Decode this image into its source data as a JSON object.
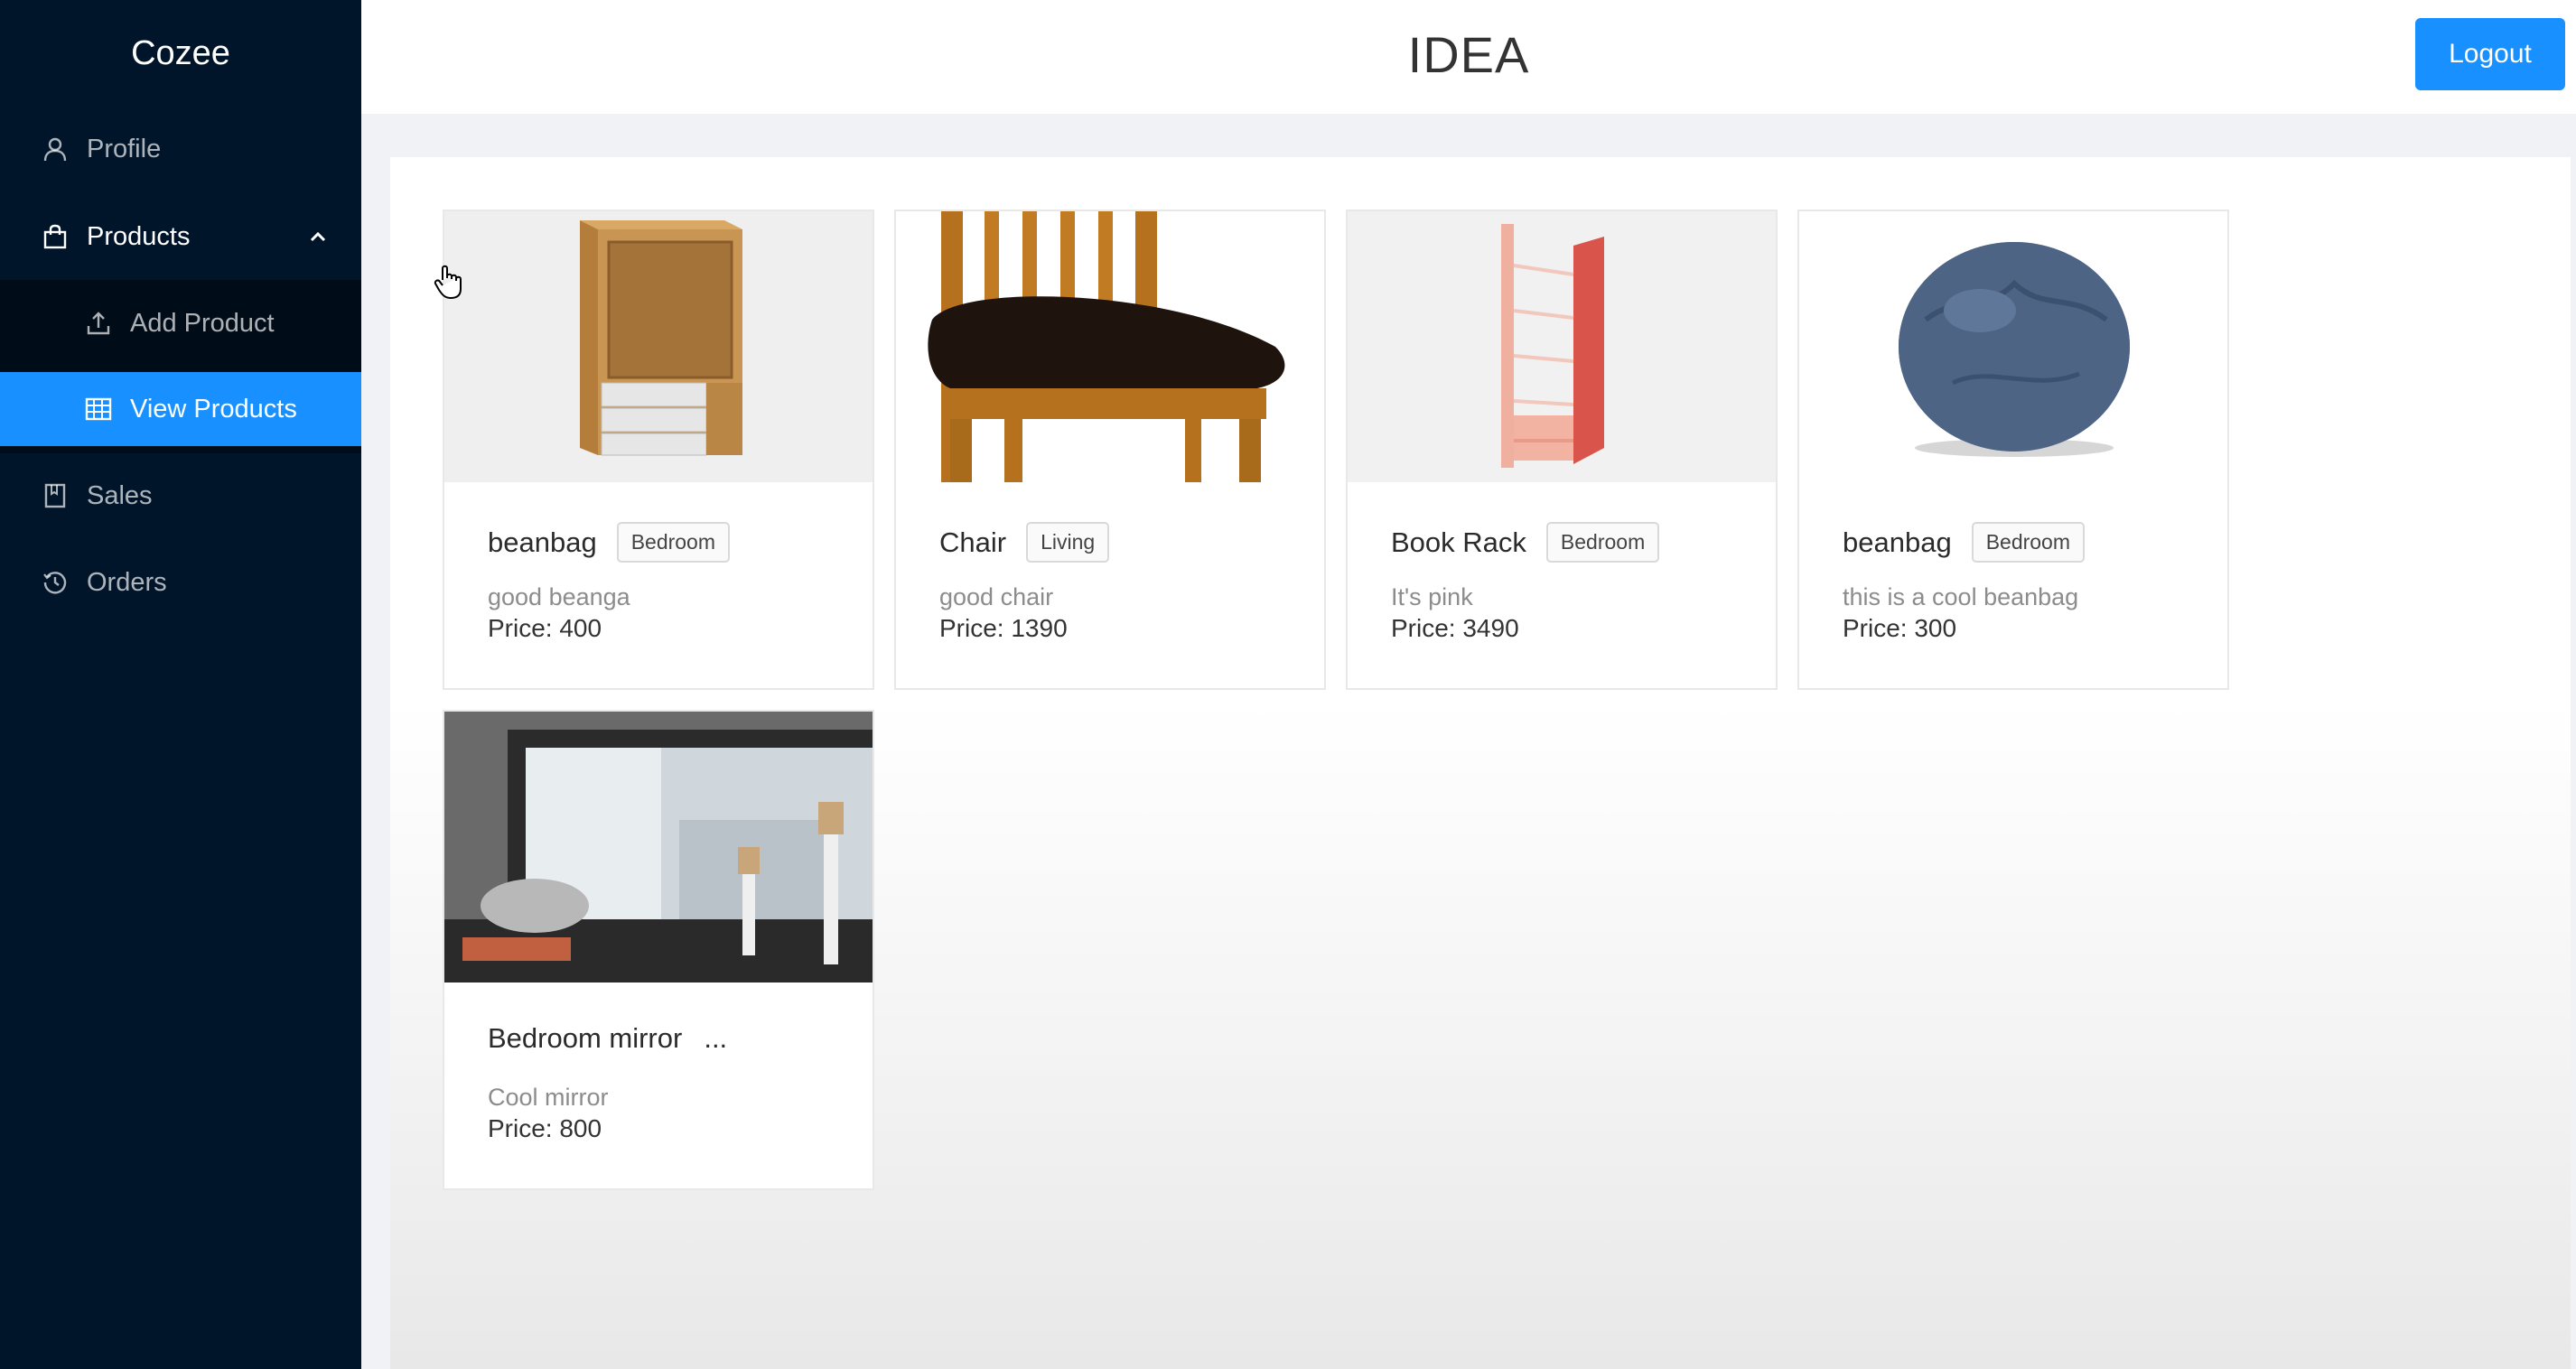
{
  "sidebar": {
    "brand": "Cozee",
    "items": [
      {
        "label": "Profile",
        "icon": "user-icon"
      },
      {
        "label": "Products",
        "icon": "shopping-bag-icon",
        "expanded": true,
        "children": [
          {
            "label": "Add Product",
            "icon": "upload-icon"
          },
          {
            "label": "View Products",
            "icon": "table-icon",
            "selected": true
          }
        ]
      },
      {
        "label": "Sales",
        "icon": "book-icon"
      },
      {
        "label": "Orders",
        "icon": "history-icon"
      }
    ]
  },
  "header": {
    "title": "IDEA",
    "logout_label": "Logout"
  },
  "products": [
    {
      "name": "beanbag",
      "tag": "Bedroom",
      "description": "good beanga",
      "price": "Price: 400",
      "image": "cabinet"
    },
    {
      "name": "Chair",
      "tag": "Living",
      "description": "good chair",
      "price": "Price: 1390",
      "image": "chair"
    },
    {
      "name": "Book Rack",
      "tag": "Bedroom",
      "description": "It's pink",
      "price": "Price: 3490",
      "image": "book-rack"
    },
    {
      "name": "beanbag",
      "tag": "Bedroom",
      "description": "this is a cool beanbag",
      "price": "Price: 300",
      "image": "beanbag"
    },
    {
      "name": "Bedroom mirror",
      "tag": "...",
      "description": "Cool mirror",
      "price": "Price: 800",
      "image": "mirror"
    }
  ],
  "colors": {
    "sidebar_bg": "#001529",
    "submenu_bg": "#000c17",
    "accent": "#1890ff"
  }
}
